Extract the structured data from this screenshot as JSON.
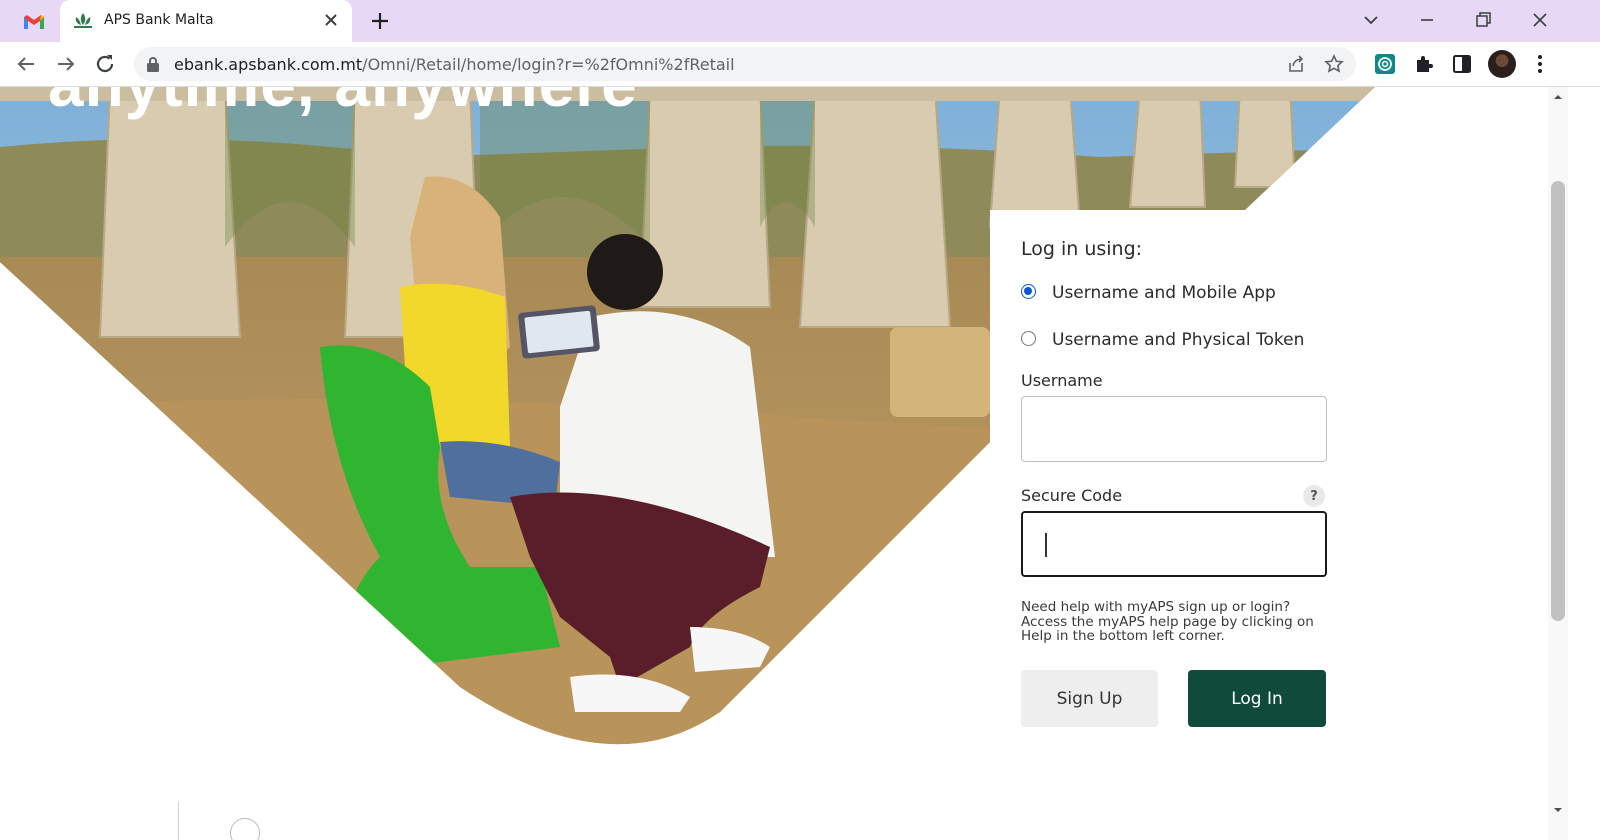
{
  "browser": {
    "tab_title": "APS Bank Malta",
    "url_host": "ebank.apsbank.com.mt",
    "url_path": "/Omni/Retail/home/login?r=%2fOmni%2fRetail"
  },
  "hero": {
    "headline": "anytime, anywhere"
  },
  "login": {
    "heading": "Log in using:",
    "options": [
      {
        "label": "Username and Mobile App",
        "selected": true
      },
      {
        "label": "Username and Physical Token",
        "selected": false
      }
    ],
    "username_label": "Username",
    "username_value": "",
    "secure_code_label": "Secure Code",
    "secure_code_value": "",
    "help_badge": "?",
    "help_text": "Need help with myAPS sign up or login? Access the myAPS help page by clicking on Help in the bottom left corner.",
    "signup_label": "Sign Up",
    "login_label": "Log In"
  },
  "colors": {
    "login_button": "#0f4a3a",
    "chair_green": "#2fb52f",
    "tabstrip": "#e7d8f5"
  }
}
